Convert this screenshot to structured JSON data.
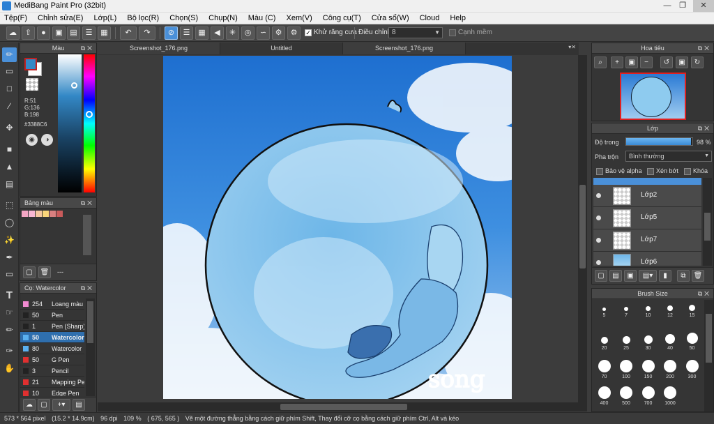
{
  "title": "MediBang Paint Pro (32bit)",
  "menu": [
    "Tệp(F)",
    "Chỉnh sửa(E)",
    "Lớp(L)",
    "Bộ lọc(R)",
    "Chọn(S)",
    "Chụp(N)",
    "Màu (C)",
    "Xem(V)",
    "Công cụ(T)",
    "Cửa sổ(W)",
    "Cloud",
    "Help"
  ],
  "toolbar": {
    "antialias_label": "Khử răng cưa",
    "adjust_label": "Điều chỉnh",
    "adjust_value": "8",
    "smooth_label": "Cạnh mềm"
  },
  "color_panel": {
    "title": "Màu",
    "r": "R:51",
    "g": "G:136",
    "b": "B:198",
    "hex": "#3388C6",
    "fg_color": "#3388C6"
  },
  "palette_panel": {
    "title": "Bảng màu",
    "colors": [
      "#f4a6c4",
      "#f7b7d2",
      "#f5c7a0",
      "#f9d57a",
      "#d98080",
      "#c95b5b"
    ],
    "dash": "---"
  },
  "brush_panel": {
    "title": "Cọ: Watercolor",
    "items": [
      {
        "color": "#f08ad0",
        "num": "254",
        "name": "Loang màu"
      },
      {
        "color": "#222222",
        "num": "50",
        "name": "Pen"
      },
      {
        "color": "#222222",
        "num": "1",
        "name": "Pen (Sharp)"
      },
      {
        "color": "#5ab0f0",
        "num": "50",
        "name": "Watercolor"
      },
      {
        "color": "#5ab0f0",
        "num": "80",
        "name": "Watercolor"
      },
      {
        "color": "#e03030",
        "num": "50",
        "name": "G Pen"
      },
      {
        "color": "#222222",
        "num": "3",
        "name": "Pencil"
      },
      {
        "color": "#e03030",
        "num": "21",
        "name": "Mapping Pen"
      },
      {
        "color": "#e03030",
        "num": "10",
        "name": "Edge Pen"
      }
    ]
  },
  "tabs": [
    "Screenshot_176.png",
    "Untitled",
    "Screenshot_176.png"
  ],
  "canvas": {
    "signature": "song"
  },
  "navigator": {
    "title": "Hoa tiêu"
  },
  "layer_panel": {
    "title": "Lớp",
    "opacity_label": "Độ trong",
    "opacity_value": "98 %",
    "opacity_fraction": 0.98,
    "blend_label": "Pha trộn",
    "blend_value": "Bình thường",
    "protect_alpha": "Bảo vệ alpha",
    "clipping": "Xén bớt",
    "lock": "Khóa",
    "layers": [
      "Lớp2",
      "Lớp5",
      "Lớp7",
      "Lớp6"
    ]
  },
  "brush_size_panel": {
    "title": "Brush Size",
    "sizes": [
      "5",
      "7",
      "10",
      "12",
      "15",
      "20",
      "25",
      "30",
      "40",
      "50",
      "70",
      "100",
      "150",
      "200",
      "300",
      "400",
      "500",
      "700",
      "1000"
    ]
  },
  "status": {
    "dims": "573 * 564 pixel",
    "cm": "(15.2 * 14.9cm)",
    "dpi": "96 dpi",
    "zoom": "109 %",
    "coords": "( 675, 565 )",
    "hint": "Vẽ một đường thẳng bằng cách giữ phím Shift, Thay đổi cỡ cọ bằng cách giữ phím Ctrl, Alt và kéo"
  }
}
